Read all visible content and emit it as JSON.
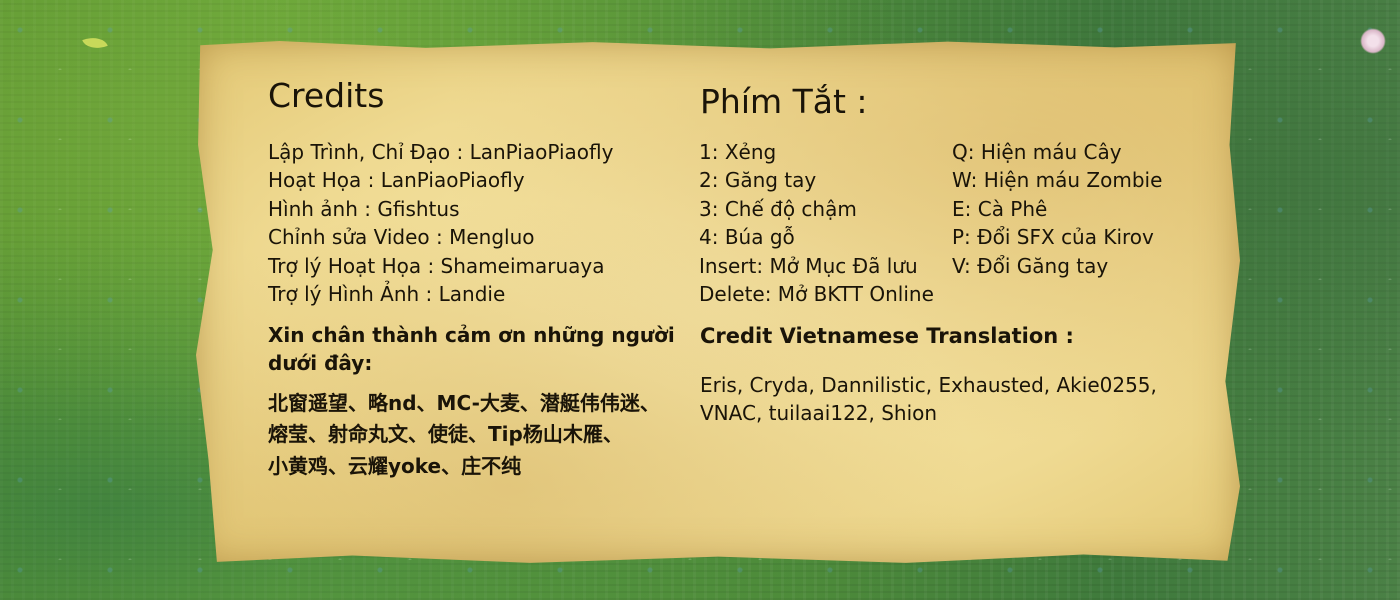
{
  "credits": {
    "title": "Credits",
    "lines": [
      "Lập Trình, Chỉ Đạo : LanPiaoPiaofly",
      "Hoạt Họa : LanPiaoPiaofly",
      "Hình ảnh : Gfishtus",
      "Chỉnh sửa Video : Mengluo",
      "Trợ lý Hoạt Họa : Shameimaruaya",
      "Trợ lý Hình Ảnh : Landie"
    ],
    "thanks_lines": [
      "Xin chân thành cảm ơn những người",
      "dưới đây:"
    ],
    "thanks_names": [
      "北窗遥望、略nd、MC-大麦、潜艇伟伟迷、",
      "熔莹、射命丸文、使徒、Tip杨山木雁、",
      "小黄鸡、云耀yoke、庄不纯"
    ]
  },
  "shortcuts": {
    "title": "Phím Tắt :",
    "left": [
      "1: Xẻng",
      "2: Găng tay",
      "3: Chế độ chậm",
      "4: Búa gỗ",
      "Insert: Mở Mục Đã lưu",
      "Delete: Mở BKTT Online"
    ],
    "right": [
      "Q: Hiện máu Cây",
      "W: Hiện máu Zombie",
      "E: Cà Phê",
      "P: Đổi SFX của Kirov",
      "V: Đổi Găng tay"
    ]
  },
  "translation": {
    "title": "Credit Vietnamese Translation :",
    "names_lines": [
      "Eris, Cryda, Dannilistic, Exhausted, Akie0255,",
      "VNAC, tuilaai122, Shion"
    ]
  }
}
